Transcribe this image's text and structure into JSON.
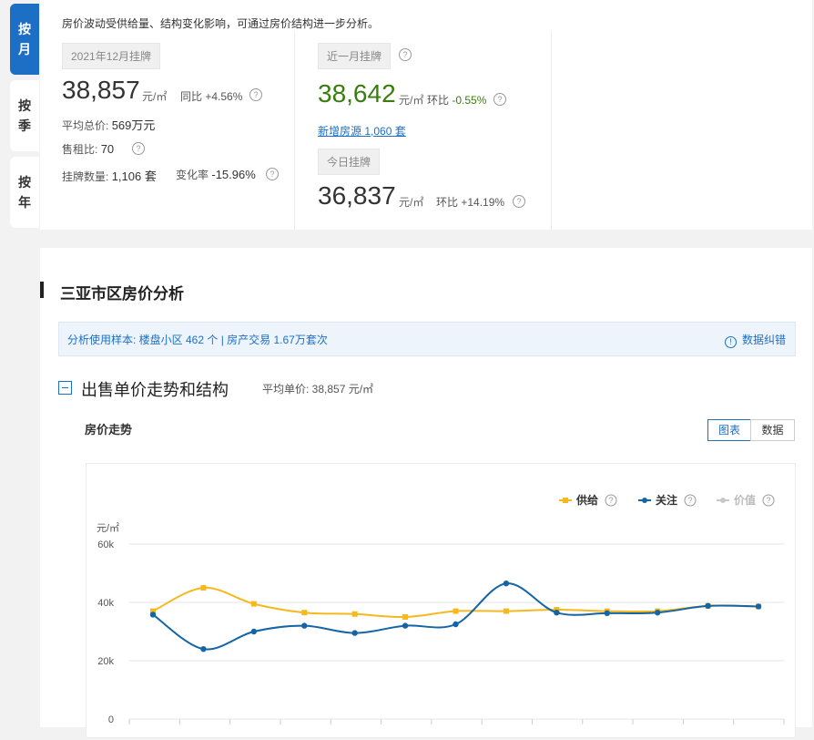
{
  "side_tabs": [
    {
      "l1": "按",
      "l2": "月"
    },
    {
      "l1": "按",
      "l2": "季"
    },
    {
      "l1": "按",
      "l2": "年"
    }
  ],
  "top": {
    "note": "房价波动受供给量、结构变化影响，可通过房价结构进一步分析。",
    "col1": {
      "tag": "2021年12月挂牌",
      "price": "38,857",
      "unit": "元/㎡",
      "yoy_label": "同比",
      "yoy": "+4.56%",
      "avg_total_label": "平均总价:",
      "avg_total": "569万元",
      "rent_ratio_label": "售租比:",
      "rent_ratio": "70",
      "listing_label": "挂牌数量:",
      "listing": "1,106 套",
      "change_label": "变化率",
      "change": "-15.96%"
    },
    "col2": {
      "tag": "近一月挂牌",
      "price": "38,642",
      "unit": "元/㎡",
      "mom_label": "环比",
      "mom": "-0.55%",
      "new_link": "新增房源 1,060 套",
      "tag2": "今日挂牌",
      "price2": "36,837",
      "unit2": "元/㎡",
      "mom2_label": "环比",
      "mom2": "+14.19%"
    }
  },
  "main": {
    "section_title": "三亚市区房价分析",
    "sample_text": "分析使用样本:   楼盘小区 462 个    |   房产交易 1.67万套次",
    "error_link": "数据纠错",
    "subtitle": "出售单价走势和结构",
    "avg_label": "平均单价:  38,857 元/㎡",
    "trend_title": "房价走势",
    "btn_chart": "图表",
    "btn_data": "数据"
  },
  "colors": {
    "accent": "#1d6fc5",
    "supply": "#f5b91e",
    "attention": "#1565a6",
    "value": "#c8c8c8",
    "green": "#3a7d0f"
  },
  "chart_data": {
    "type": "line",
    "ylabel": "元/㎡",
    "ylim": [
      0,
      60000
    ],
    "yticks": [
      "0",
      "20k",
      "40k",
      "60k"
    ],
    "x": [
      1,
      2,
      3,
      4,
      5,
      6,
      7,
      8,
      9,
      10,
      11,
      12,
      13
    ],
    "legend_position": "top-right",
    "series": [
      {
        "name": "供给",
        "color": "#f5b91e",
        "marker": "square",
        "values": [
          37000,
          45000,
          39500,
          36500,
          36000,
          35000,
          37000,
          37000,
          37500,
          37000,
          37000,
          38800,
          38600
        ]
      },
      {
        "name": "关注",
        "color": "#1565a6",
        "marker": "circle",
        "values": [
          35800,
          24000,
          30000,
          32000,
          29500,
          32000,
          32500,
          46500,
          36500,
          36300,
          36500,
          38800,
          38600
        ]
      },
      {
        "name": "价值",
        "color": "#c8c8c8",
        "marker": "circle",
        "values": []
      }
    ]
  }
}
